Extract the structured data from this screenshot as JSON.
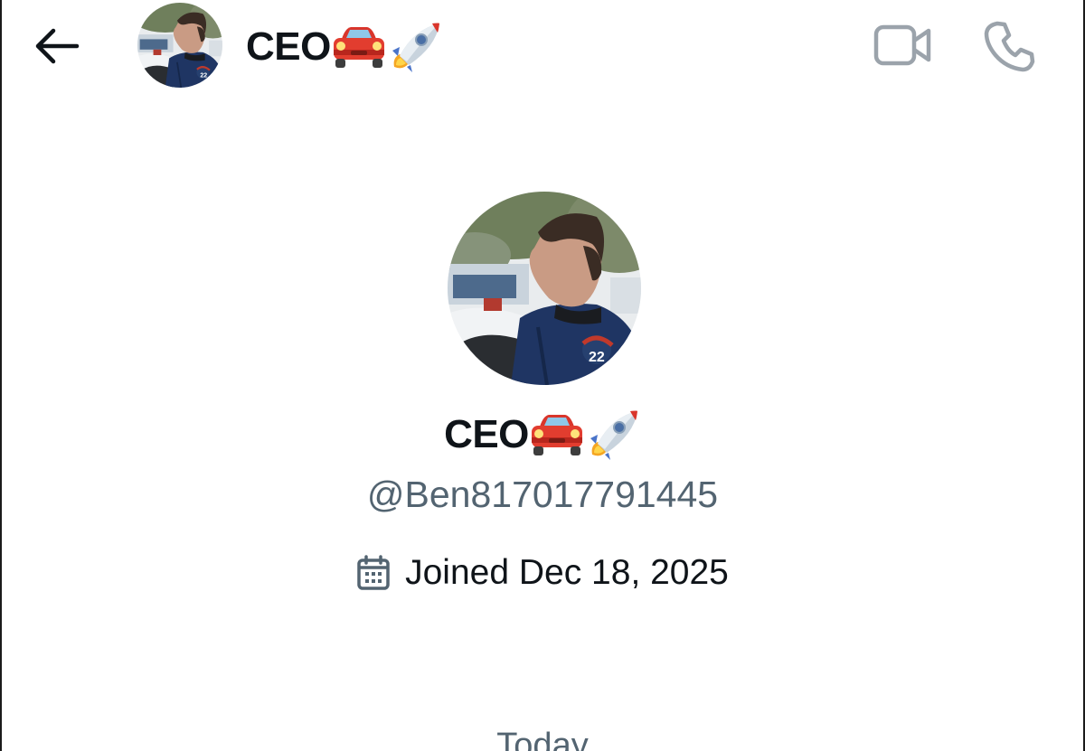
{
  "header": {
    "back_icon": "arrow-left-icon",
    "title_text": "CEO",
    "title_emojis": [
      "car-emoji",
      "rocket-emoji"
    ],
    "video_icon": "video-camera-icon",
    "phone_icon": "phone-icon"
  },
  "profile": {
    "name_text": "CEO",
    "name_emojis": [
      "car-emoji",
      "rocket-emoji"
    ],
    "handle": "@Ben817017791445",
    "joined_icon": "calendar-icon",
    "joined_text": "Joined Dec 18, 2025"
  },
  "conversation": {
    "date_divider": "Today"
  },
  "colors": {
    "text_primary": "#0f1419",
    "text_secondary": "#536471",
    "icon_gray": "#9ba3ab",
    "background": "#ffffff"
  }
}
